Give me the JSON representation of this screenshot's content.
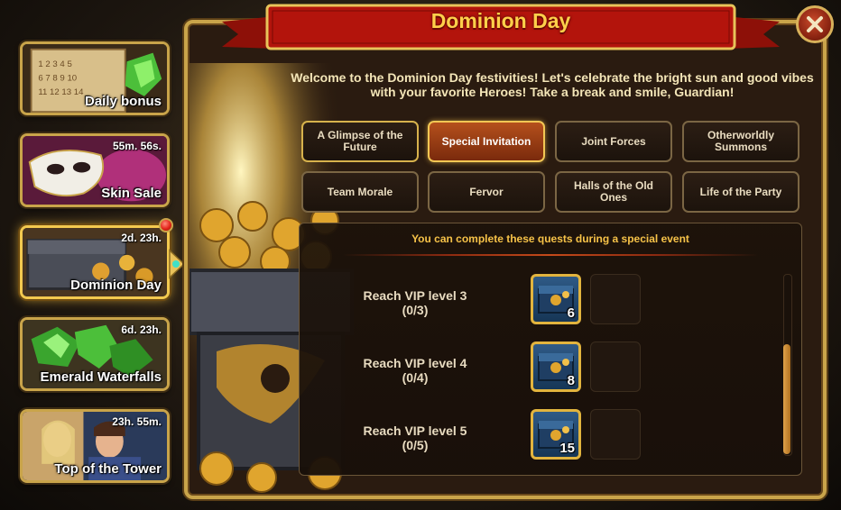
{
  "sidebar": {
    "events": [
      {
        "label": "Daily bonus",
        "timer": "",
        "icon": "calendar-icon",
        "active": false
      },
      {
        "label": "Skin Sale",
        "timer": "55m. 56s.",
        "icon": "mask-icon",
        "active": false
      },
      {
        "label": "Dominion Day",
        "timer": "2d. 23h.",
        "icon": "chest-icon",
        "active": true
      },
      {
        "label": "Emerald Waterfalls",
        "timer": "6d. 23h.",
        "icon": "emerald-icon",
        "active": false
      },
      {
        "label": "Top of the Tower",
        "timer": "23h. 55m.",
        "icon": "heroes-icon",
        "active": false
      }
    ]
  },
  "panel": {
    "title": "Dominion Day",
    "close_icon": "close-icon",
    "welcome": "Welcome to the Dominion Day festivities! Let's celebrate the bright sun and good vibes with your favorite Heroes! Take a break and smile, Guardian!",
    "tabs": [
      {
        "label": "A Glimpse of the Future",
        "selected": false
      },
      {
        "label": "Special Invitation",
        "selected": true
      },
      {
        "label": "Joint Forces",
        "selected": false
      },
      {
        "label": "Otherworldly Summons",
        "selected": false
      },
      {
        "label": "Team Morale",
        "selected": false
      },
      {
        "label": "Fervor",
        "selected": false
      },
      {
        "label": "Halls of the Old Ones",
        "selected": false
      },
      {
        "label": "Life of the Party",
        "selected": false
      }
    ],
    "quest_header": "You can complete these quests during a special event",
    "quests": [
      {
        "name": "Reach VIP level 3",
        "progress": "(0/3)",
        "reward_icon": "chest-icon",
        "reward_count": "6"
      },
      {
        "name": "Reach VIP level 4",
        "progress": "(0/4)",
        "reward_icon": "chest-icon",
        "reward_count": "8"
      },
      {
        "name": "Reach VIP level 5",
        "progress": "(0/5)",
        "reward_icon": "chest-icon",
        "reward_count": "15"
      }
    ]
  },
  "colors": {
    "gold_border": "#c9a44a",
    "title_gold": "#ffd04a",
    "banner_red": "#b3140c",
    "selected_tab": "#b5501c",
    "reward_blue": "#2f5a86"
  }
}
